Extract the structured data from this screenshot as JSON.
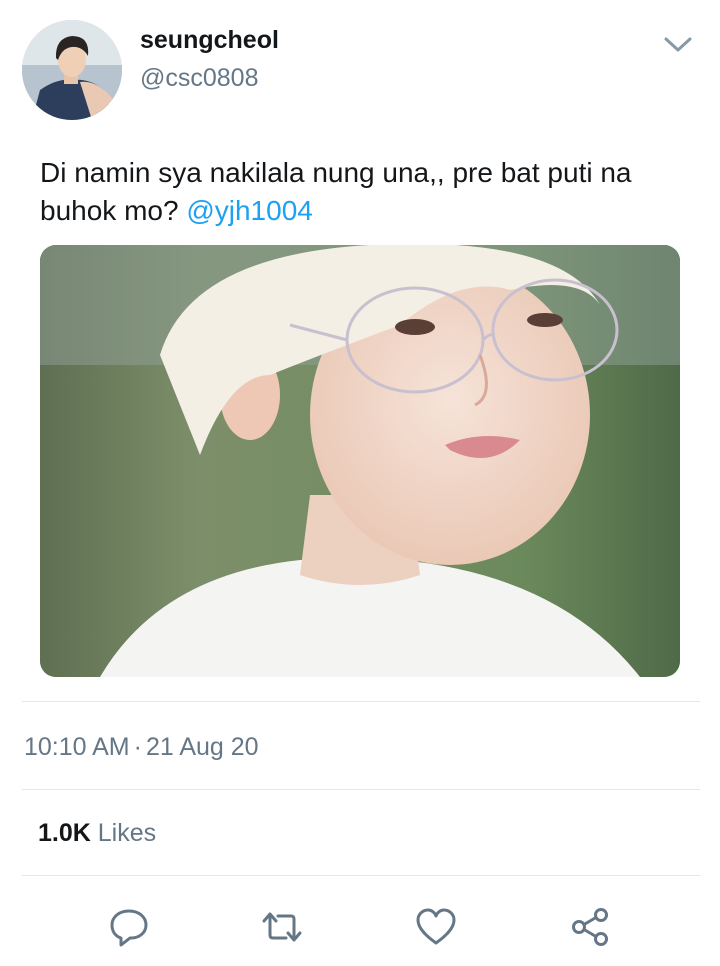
{
  "author": {
    "display_name": "seungcheol",
    "handle": "@csc0808"
  },
  "tweet": {
    "text": "Di namin sya nakilala nung una,, pre bat puti na buhok mo? ",
    "mention": "@yjh1004"
  },
  "meta": {
    "time": "10:10 AM",
    "separator": "·",
    "date": "21 Aug 20"
  },
  "stats": {
    "likes_count": "1.0K",
    "likes_label": "Likes"
  },
  "icons": {
    "menu": "chevron-down-icon",
    "reply": "reply-icon",
    "retweet": "retweet-icon",
    "like": "heart-icon",
    "share": "share-icon"
  },
  "colors": {
    "link": "#1da1f2",
    "secondary_text": "#657786",
    "primary_text": "#14171a",
    "icon": "#657786"
  }
}
